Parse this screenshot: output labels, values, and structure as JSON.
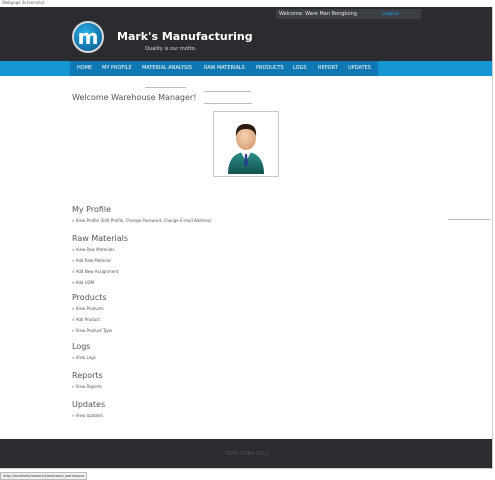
{
  "browser": {
    "caption": "Webpage Screenshot",
    "status_url": "http://localhost/maverick/welcome_warehouse"
  },
  "header": {
    "welcome_text": "Welcome: Ware Man Bongbong",
    "logout_label": "Logout",
    "logo_letter": "m",
    "brand_name": "Mark's Manufacturing",
    "motto": "Quality is our motto."
  },
  "nav": {
    "items": [
      "HOME",
      "MY PROFILE",
      "MATERIAL ANALYSIS",
      "RAW MATERIALS",
      "PRODUCTS",
      "LOGS",
      "REPORT",
      "UPDATES"
    ]
  },
  "main": {
    "welcome_title": "Welcome Warehouse Manager!"
  },
  "sections": [
    {
      "title": "My Profile",
      "links": [
        "» View Profile (Edit Profile, Change Password, Change E-mail Address)"
      ]
    },
    {
      "title": "Raw Materials",
      "links": [
        "» View Raw Materials",
        "» Add Raw Material",
        "» Add New Assignment",
        "» Add UOM"
      ]
    },
    {
      "title": "Products",
      "links": [
        "» View Products",
        "» Add Product",
        "» View Product Type"
      ]
    },
    {
      "title": "Logs",
      "links": [
        "» View Logs"
      ]
    },
    {
      "title": "Reports",
      "links": [
        "» View Reports"
      ]
    },
    {
      "title": "Updates",
      "links": [
        "» View Updates"
      ]
    }
  ],
  "footer": {
    "text": "TEAM COBA 2012"
  },
  "colors": {
    "header_bg": "#2a2c2f",
    "nav_bg": "#1596d3",
    "nav_active_bg": "#0f78b2",
    "link_accent": "#1ea0e0"
  }
}
